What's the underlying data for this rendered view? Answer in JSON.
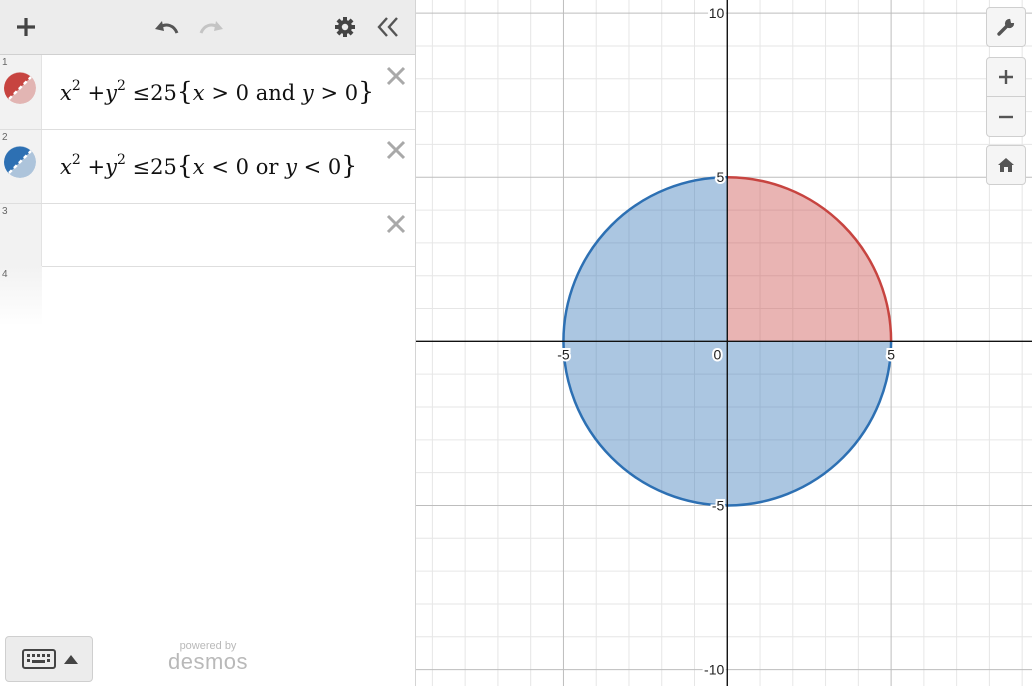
{
  "toolbar": {
    "add_icon": "plus-icon",
    "undo_icon": "undo-icon",
    "redo_icon": "redo-icon",
    "settings_icon": "gear-icon",
    "collapse_icon": "double-chevron-left-icon"
  },
  "expressions": [
    {
      "index": "1",
      "color": "#c74440",
      "latex": "x^2+y^2\\le 25\\{x>0 and y>0\\}",
      "parts": {
        "x": "x",
        "exp1": "2",
        "plus": "+",
        "y": "y",
        "exp2": "2",
        "rel": "≤",
        "rhs": "25",
        "lbrace": "{",
        "c1v": "x",
        "c1op": ">",
        "c1n": "0",
        "join": "and",
        "c2v": "y",
        "c2op": ">",
        "c2n": "0",
        "rbrace": "}"
      }
    },
    {
      "index": "2",
      "color": "#2d70b3",
      "latex": "x^2+y^2\\le 25\\{x<0 or y<0\\}",
      "parts": {
        "x": "x",
        "exp1": "2",
        "plus": "+",
        "y": "y",
        "exp2": "2",
        "rel": "≤",
        "rhs": "25",
        "lbrace": "{",
        "c1v": "x",
        "c1op": "<",
        "c1n": "0",
        "join": "or",
        "c2v": "y",
        "c2op": "<",
        "c2n": "0",
        "rbrace": "}"
      }
    },
    {
      "index": "3",
      "latex": ""
    },
    {
      "index": "4",
      "latex": ""
    }
  ],
  "footer": {
    "keyboard_icon": "keyboard-icon",
    "powered_by": "powered by",
    "brand": "desmos"
  },
  "graph_controls": [
    "wrench-icon",
    "zoom-in-icon",
    "zoom-out-icon",
    "home-icon"
  ],
  "chart_data": {
    "type": "area",
    "xlim": [
      -9.5,
      9.3
    ],
    "ylim": [
      -10.5,
      10.4
    ],
    "grid": true,
    "major_grid_step": 5,
    "minor_grid_step": 1,
    "x_tick_labels": [
      "-5",
      "0",
      "5"
    ],
    "y_tick_labels": [
      "10",
      "5",
      "-5",
      "-10"
    ],
    "series": [
      {
        "color": "#c74440",
        "region": "x^2+y^2<=25, x>0 and y>0",
        "radius": 5
      },
      {
        "color": "#2d70b3",
        "region": "x^2+y^2<=25, x<0 or y<0",
        "radius": 5
      }
    ]
  }
}
